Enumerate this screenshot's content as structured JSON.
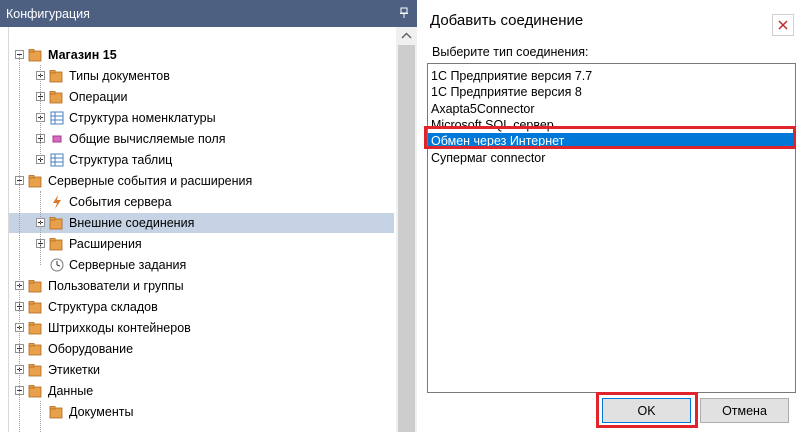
{
  "panel": {
    "title": "Конфигурация",
    "tree": [
      {
        "label": "Магазин 15",
        "bold": true,
        "level": 0,
        "expander": "minus",
        "icon": "store-folder-icon"
      },
      {
        "label": "Типы документов",
        "level": 1,
        "expander": "plus",
        "icon": "document-types-icon"
      },
      {
        "label": "Операции",
        "level": 1,
        "expander": "plus",
        "icon": "operations-icon"
      },
      {
        "label": "Структура номенклатуры",
        "level": 1,
        "expander": "plus",
        "icon": "table-grid-icon"
      },
      {
        "label": "Общие вычисляемые поля",
        "level": 1,
        "expander": "plus",
        "icon": "calculated-fields-icon"
      },
      {
        "label": "Структура таблиц",
        "level": 1,
        "expander": "plus",
        "icon": "table-structure-icon"
      },
      {
        "label": "Серверные события и расширения",
        "level": 0,
        "expander": "minus",
        "icon": "server-folder-icon"
      },
      {
        "label": "События сервера",
        "level": 1,
        "expander": "none",
        "icon": "lightning-icon"
      },
      {
        "label": "Внешние соединения",
        "level": 1,
        "expander": "plus",
        "icon": "external-connection-icon",
        "selected": true
      },
      {
        "label": "Расширения",
        "level": 1,
        "expander": "plus",
        "icon": "extensions-folder-icon"
      },
      {
        "label": "Серверные задания",
        "level": 1,
        "expander": "none",
        "icon": "clock-icon"
      },
      {
        "label": "Пользователи и группы",
        "level": 0,
        "expander": "plus",
        "icon": "users-folder-icon"
      },
      {
        "label": "Структура складов",
        "level": 0,
        "expander": "plus",
        "icon": "warehouse-folder-icon"
      },
      {
        "label": "Штрихкоды контейнеров",
        "level": 0,
        "expander": "plus",
        "icon": "barcode-folder-icon"
      },
      {
        "label": "Оборудование",
        "level": 0,
        "expander": "plus",
        "icon": "equipment-folder-icon"
      },
      {
        "label": "Этикетки",
        "level": 0,
        "expander": "plus",
        "icon": "labels-folder-icon"
      },
      {
        "label": "Данные",
        "level": 0,
        "expander": "minus",
        "icon": "data-folder-icon"
      },
      {
        "label": "Документы",
        "level": 1,
        "expander": "none",
        "icon": "documents-folder-icon"
      }
    ]
  },
  "dialog": {
    "title": "Добавить соединение",
    "type_label": "Выберите тип соединения:",
    "items": [
      {
        "label": "1С Предприятие версия 7.7"
      },
      {
        "label": "1С Предприятие версия 8"
      },
      {
        "label": "Axapta5Connector"
      },
      {
        "label": "Microsoft SQL сервер"
      },
      {
        "label": "Обмен через Интернет",
        "selected": true
      },
      {
        "label": "Супермаг connector"
      }
    ],
    "ok_label": "OK",
    "cancel_label": "Отмена"
  },
  "colors": {
    "header_bg": "#4d6082",
    "tree_selected": "#c5d3e4",
    "list_selected": "#0078d7",
    "highlight_red": "#e0242c"
  }
}
